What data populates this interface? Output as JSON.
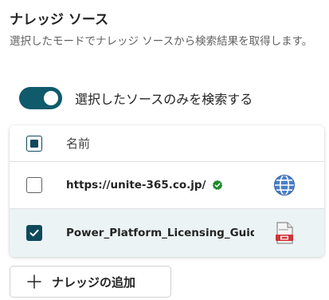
{
  "section": {
    "title": "ナレッジ ソース",
    "description": "選択したモードでナレッジ ソースから検索結果を取得します。"
  },
  "toggle": {
    "label": "選択したソースのみを検索する",
    "state": "on",
    "color": "#0f5a6b"
  },
  "table": {
    "header": {
      "column_name": "名前",
      "select_all_state": "partial"
    },
    "rows": [
      {
        "name": "https://unite-365.co.jp/",
        "checked": false,
        "verified": true,
        "type_icon": "globe-icon"
      },
      {
        "name": "Power_Platform_Licensing_Guide",
        "checked": true,
        "verified": false,
        "type_icon": "pdf-file-icon"
      }
    ]
  },
  "add_button": {
    "label": "ナレッジの追加",
    "icon": "plus-icon"
  },
  "colors": {
    "accent": "#0f4a5c",
    "verified_green": "#1f8a2a",
    "selected_row_bg": "#ecf3f5",
    "pdf_red": "#d13438"
  }
}
